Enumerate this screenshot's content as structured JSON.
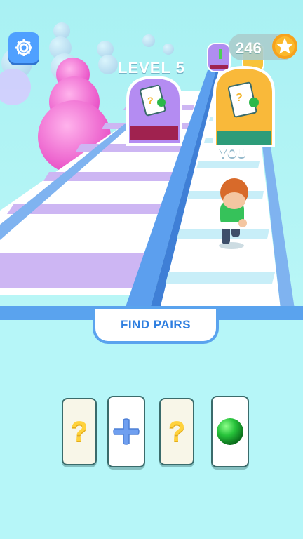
{
  "hud": {
    "coins": "246",
    "settings_icon": "gear-icon",
    "coin_icon": "star-coin-icon"
  },
  "game": {
    "level_label": "LEVEL 5",
    "player_tag": "YOU",
    "gate_left_mark": "?",
    "gate_right_mark": "?"
  },
  "panel": {
    "title": "FIND PAIRS",
    "cards": [
      {
        "state": "hidden",
        "symbol": "?"
      },
      {
        "state": "revealed",
        "icon": "blue-plus-icon"
      },
      {
        "state": "hidden",
        "symbol": "?"
      },
      {
        "state": "revealed",
        "icon": "green-ball-icon"
      }
    ]
  },
  "colors": {
    "accent_blue": "#5aa3ee",
    "banner_text": "#2f7fe0",
    "question_yellow": "#ffd23c",
    "sky": "#aef3f3"
  }
}
